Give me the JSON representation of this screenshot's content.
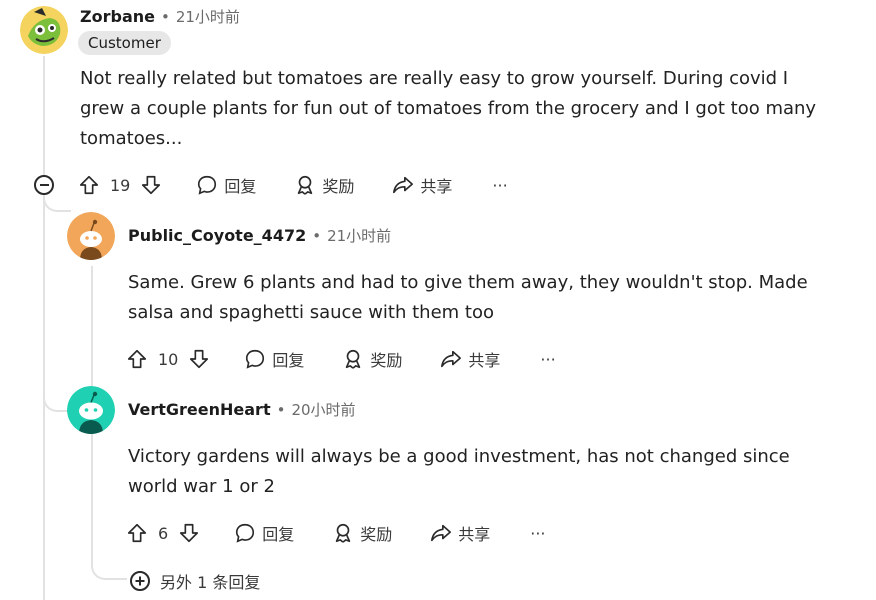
{
  "comments": [
    {
      "author": "Zorbane",
      "separator": "•",
      "time": "21小时前",
      "flair": "Customer",
      "body_lines": [
        "Not really related but tomatoes are really easy to grow yourself. During covid I",
        "grew a couple plants for fun out of tomatoes from the grocery and I got too many",
        "tomatoes..."
      ],
      "votes": "19",
      "reply_label": "回复",
      "award_label": "奖励",
      "share_label": "共享",
      "more_label": "···"
    },
    {
      "author": "Public_Coyote_4472",
      "separator": "•",
      "time": "21小时前",
      "body_lines": [
        "Same. Grew 6 plants and had to give them away, they wouldn't stop. Made",
        "salsa and spaghetti sauce with them too"
      ],
      "votes": "10",
      "reply_label": "回复",
      "award_label": "奖励",
      "share_label": "共享",
      "more_label": "···"
    },
    {
      "author": "VertGreenHeart",
      "separator": "•",
      "time": "20小时前",
      "body_lines": [
        "Victory gardens will always be a good investment, has not changed since",
        "world war 1 or 2"
      ],
      "votes": "6",
      "reply_label": "回复",
      "award_label": "奖励",
      "share_label": "共享",
      "more_label": "···"
    }
  ],
  "more_replies": "另外 1 条回复",
  "colors": {
    "avatar_1_bg": "#f4d35e",
    "avatar_1_accent": "#7bbf3a",
    "avatar_2_bg": "#f2a65a",
    "avatar_3_bg": "#1fd1b2",
    "thread_line": "#e2e2e2"
  }
}
